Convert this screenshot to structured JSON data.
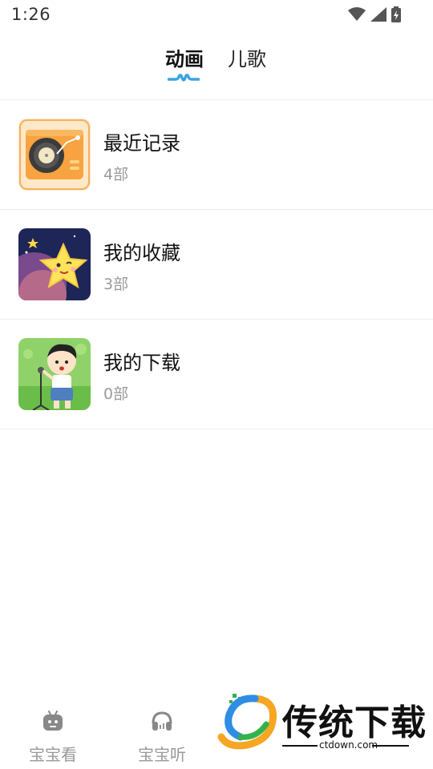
{
  "status_bar": {
    "time": "1:26"
  },
  "tabs": [
    {
      "label": "动画",
      "active": true
    },
    {
      "label": "儿歌",
      "active": false
    }
  ],
  "list": [
    {
      "title": "最近记录",
      "count": "4部",
      "icon": "record-player-thumbnail"
    },
    {
      "title": "我的收藏",
      "count": "3部",
      "icon": "star-character-thumbnail"
    },
    {
      "title": "我的下载",
      "count": "0部",
      "icon": "singing-boy-thumbnail"
    }
  ],
  "bottom_nav": [
    {
      "label": "宝宝看",
      "icon": "robot-icon"
    },
    {
      "label": "宝宝听",
      "icon": "headphones-icon"
    }
  ],
  "watermark": {
    "text": "传统下载",
    "url": "ctdown.com"
  },
  "colors": {
    "accent": "#3aa3e3",
    "muted": "#9a9a9a",
    "divider": "#eeeeee"
  }
}
